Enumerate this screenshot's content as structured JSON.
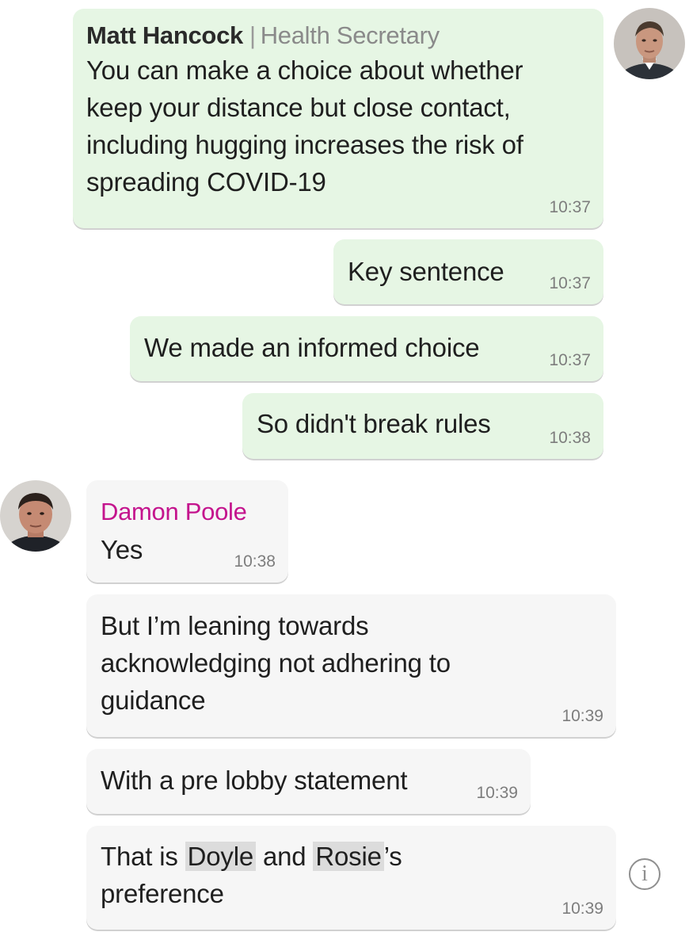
{
  "messages": [
    {
      "sender_name": "Matt Hancock",
      "sender_role": "Health Secretary",
      "text": "You can make a choice about whether\nkeep your distance but close contact,\nincluding hugging increases the risk of\nspreading COVID-19",
      "time": "10:37"
    },
    {
      "text": "Key sentence",
      "time": "10:37"
    },
    {
      "text": "We made an informed choice",
      "time": "10:37"
    },
    {
      "text": "So didn't break rules",
      "time": "10:38"
    },
    {
      "sender_name": "Damon Poole",
      "text": "Yes",
      "time": "10:38"
    },
    {
      "text": "But I’m leaning towards\nacknowledging not adhering to\nguidance",
      "time": "10:39"
    },
    {
      "text": "With a pre lobby statement",
      "time": "10:39"
    },
    {
      "text_parts": [
        "That is ",
        "Doyle",
        " and ",
        "Rosie",
        "’s",
        "preference"
      ],
      "time": "10:39"
    }
  ],
  "avatars": [
    {
      "name": "Matt Hancock",
      "icon": "person-photo"
    },
    {
      "name": "Damon Poole",
      "icon": "person-photo"
    }
  ],
  "info_icon": {
    "glyph": "i"
  },
  "colors": {
    "outgoing_bubble": "#e6f6e4",
    "incoming_bubble": "#f6f6f6",
    "incoming_sender_name": "#c4148d"
  }
}
